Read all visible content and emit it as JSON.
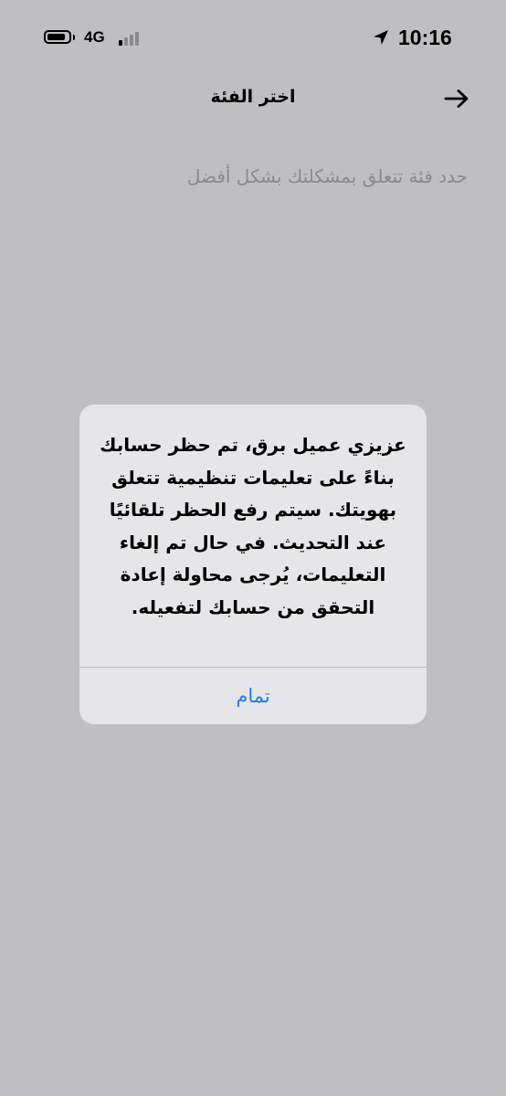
{
  "status_bar": {
    "network": "4G",
    "time": "10:16",
    "battery_level": 0.85,
    "signal_bars_active": 1,
    "signal_bars_total": 4
  },
  "nav": {
    "title": "اختر الفئة",
    "back_icon": "arrow-right-icon"
  },
  "content": {
    "subtitle": "حدد فئة تتعلق بمشكلتك بشكل أفضل"
  },
  "alert": {
    "message": "عزيزي عميل برق، تم حظر حسابك بناءً على تعليمات تنظيمية تتعلق بهويتك. سيتم رفع الحظر تلقائيًا عند التحديث. في حال تم إلغاء التعليمات، يُرجى محاولة إعادة التحقق من حسابك لتفعيله.",
    "button_label": "تمام"
  },
  "colors": {
    "background": "#bfbfc2",
    "alert_background": "#e6e6e8",
    "accent": "#1e7cf2",
    "subtitle": "#8a8a8e"
  }
}
